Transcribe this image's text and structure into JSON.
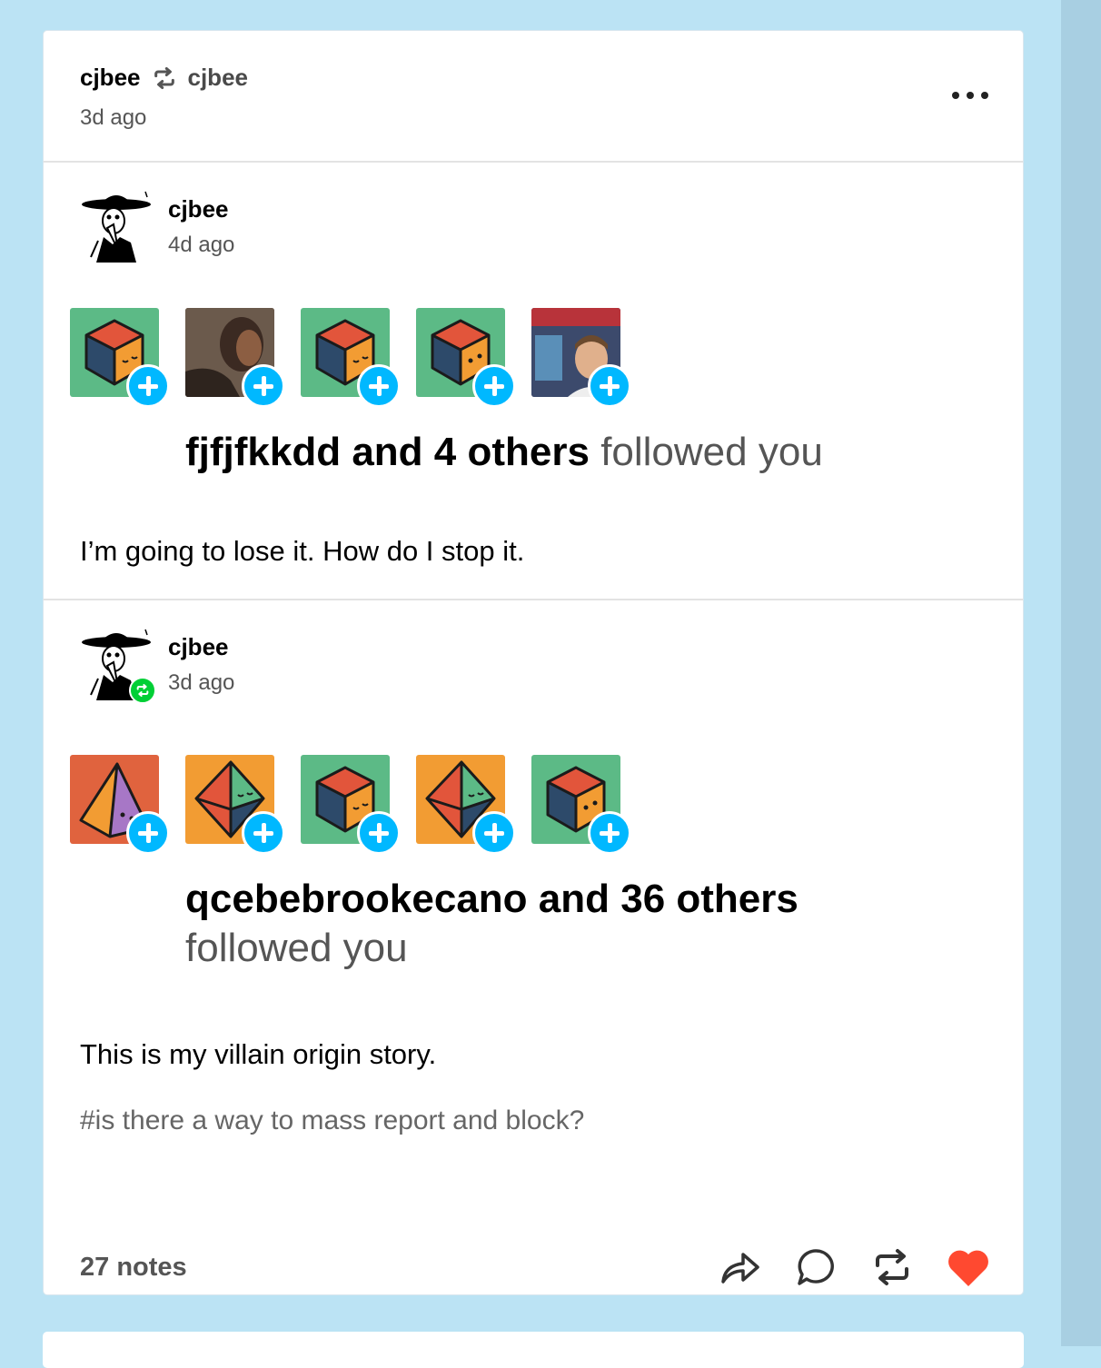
{
  "header": {
    "blog_name": "cjbee",
    "reblog_source": "cjbee",
    "timestamp": "3d ago"
  },
  "entries": [
    {
      "author": "cjbee",
      "timestamp": "4d ago",
      "followers": [
        {
          "kind": "cube",
          "bg": "#5cba86"
        },
        {
          "kind": "photo",
          "bg": "#5a4a3e"
        },
        {
          "kind": "cube",
          "bg": "#5cba86"
        },
        {
          "kind": "cube",
          "bg": "#5cba86"
        },
        {
          "kind": "photo",
          "bg": "#8a6a6a"
        }
      ],
      "follow_names": "fjfjfkkdd and 4 others",
      "follow_suffix": "followed you",
      "body": "I’m going to lose it. How do I stop it."
    },
    {
      "author": "cjbee",
      "timestamp": "3d ago",
      "followers": [
        {
          "kind": "pyramid",
          "bg": "#e0633e"
        },
        {
          "kind": "octahedron",
          "bg": "#f29c33"
        },
        {
          "kind": "cube",
          "bg": "#5cba86"
        },
        {
          "kind": "octahedron",
          "bg": "#f29c33"
        },
        {
          "kind": "cube",
          "bg": "#5cba86"
        }
      ],
      "follow_names": "qcebebrookecano and 36 others",
      "follow_suffix": "followed you",
      "body": "This is my villain origin story.",
      "tag": "#is there a way to mass report and block?"
    }
  ],
  "footer": {
    "notes": "27 notes",
    "icons": [
      "share-icon",
      "comment-icon",
      "reblog-icon",
      "like-icon"
    ]
  },
  "colors": {
    "background": "#bbe3f4",
    "accent": "#00b8ff",
    "like": "#ff4930",
    "reblog": "#00cf35"
  }
}
